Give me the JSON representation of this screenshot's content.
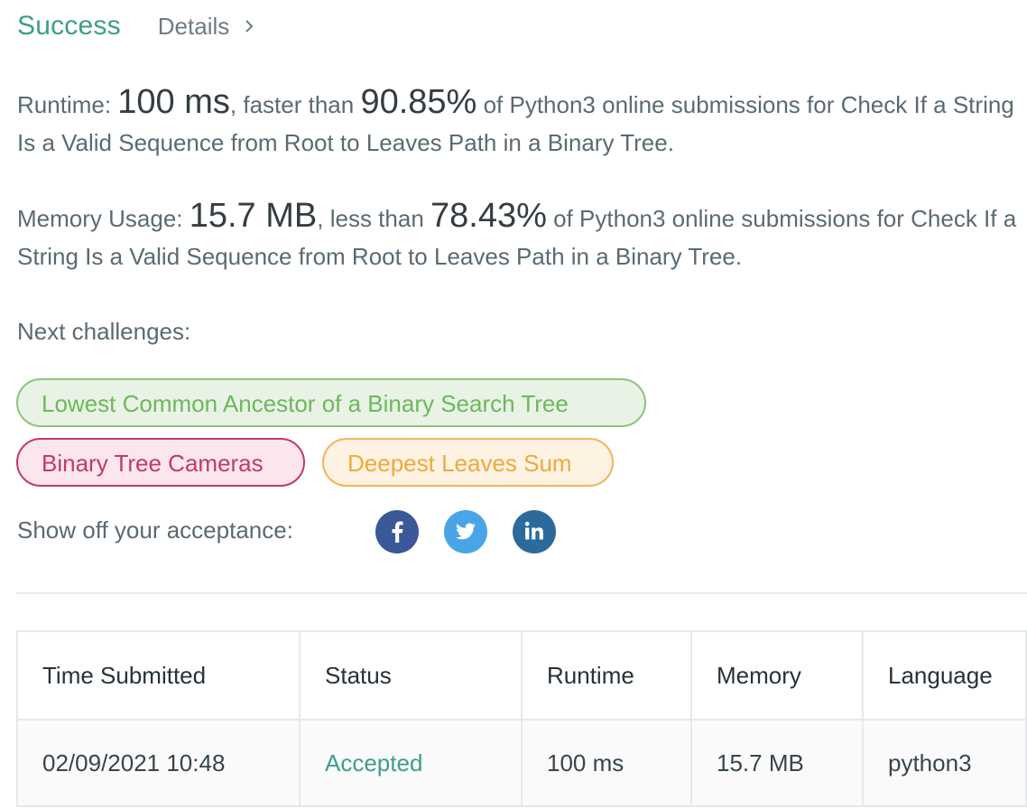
{
  "header": {
    "status": "Success",
    "details_link": "Details"
  },
  "runtime": {
    "label": "Runtime:",
    "value": "100 ms",
    "mid": ", faster than",
    "percent": "90.85%",
    "tail": "of Python3 online submissions for Check If a String Is a Valid Sequence from Root to Leaves Path in a Binary Tree."
  },
  "memory": {
    "label": "Memory Usage:",
    "value": "15.7 MB",
    "mid": ", less than",
    "percent": "78.43%",
    "tail": "of Python3 online submissions for Check If a String Is a Valid Sequence from Root to Leaves Path in a Binary Tree."
  },
  "next_challenges": {
    "label": "Next challenges:",
    "items": [
      {
        "title": "Lowest Common Ancestor of a Binary Search Tree",
        "difficulty": "easy",
        "color": "#6cb85a"
      },
      {
        "title": "Binary Tree Cameras",
        "difficulty": "hard",
        "color": "#c23a66"
      },
      {
        "title": "Deepest Leaves Sum",
        "difficulty": "medium",
        "color": "#efa93c"
      }
    ]
  },
  "share": {
    "label": "Show off your acceptance:",
    "icons": [
      "facebook-icon",
      "twitter-icon",
      "linkedin-icon"
    ]
  },
  "submissions": {
    "columns": [
      "Time Submitted",
      "Status",
      "Runtime",
      "Memory",
      "Language"
    ],
    "rows": [
      {
        "time": "02/09/2021 10:48",
        "status": "Accepted",
        "runtime": "100 ms",
        "memory": "15.7 MB",
        "language": "python3"
      }
    ]
  },
  "colors": {
    "success": "#3d9d8c",
    "facebook": "#3b5998",
    "twitter": "#4aa5e6",
    "linkedin": "#2c6a9c"
  }
}
